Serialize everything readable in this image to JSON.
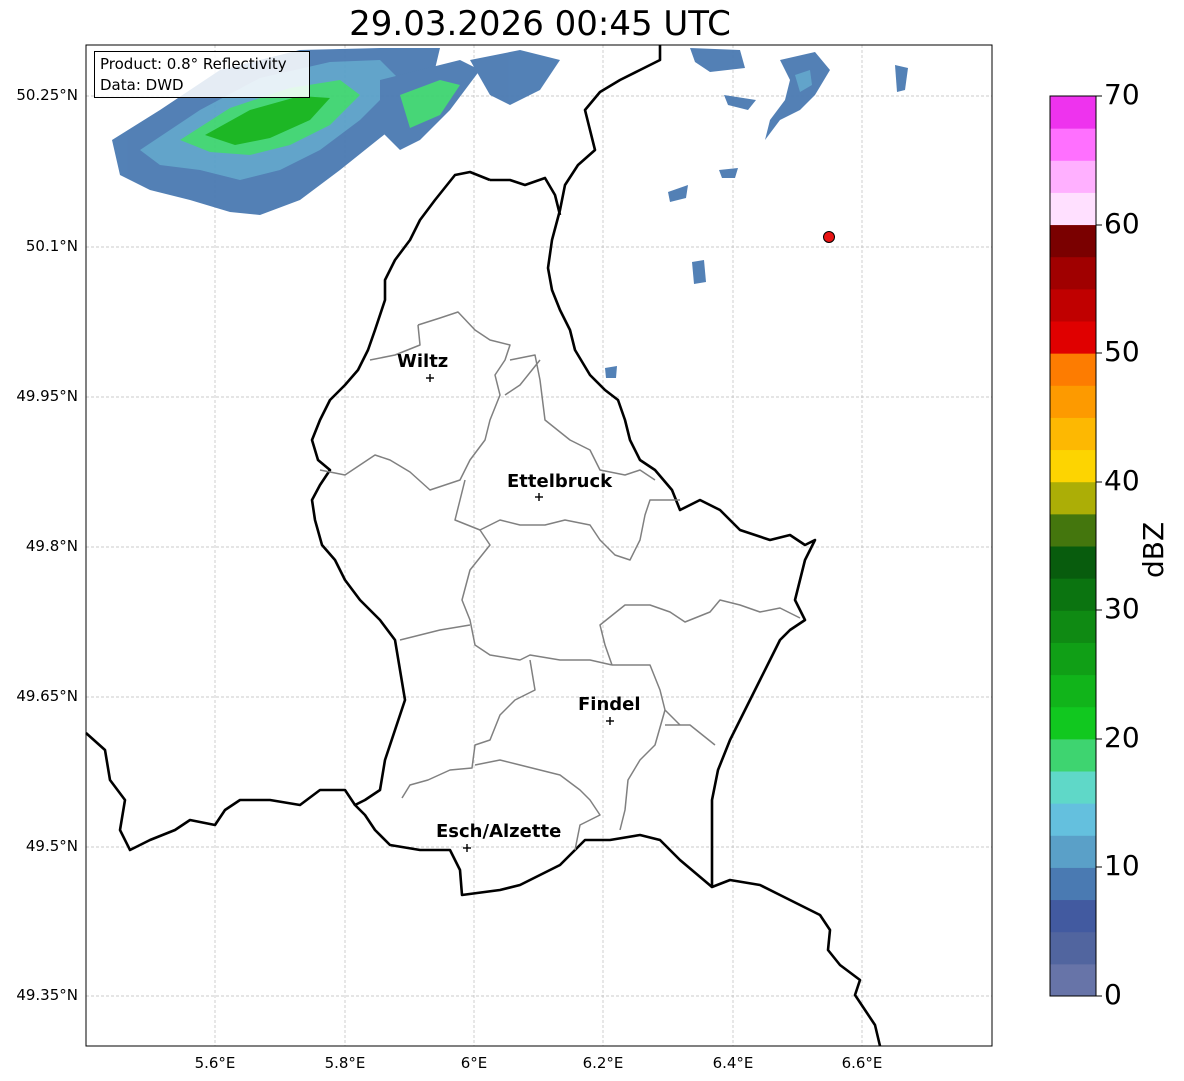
{
  "title": "29.03.2026 00:45 UTC",
  "info_box": {
    "product": "Product: 0.8° Reflectivity",
    "source": "Data: DWD"
  },
  "axes": {
    "lat_ticks": [
      "50.25°N",
      "50.1°N",
      "49.95°N",
      "49.8°N",
      "49.65°N",
      "49.5°N",
      "49.35°N"
    ],
    "lon_ticks": [
      "5.6°E",
      "5.8°E",
      "6°E",
      "6.2°E",
      "6.4°E",
      "6.6°E"
    ]
  },
  "cities": [
    {
      "name": "Wiltz"
    },
    {
      "name": "Ettelbruck"
    },
    {
      "name": "Findel"
    },
    {
      "name": "Esch/Alzette"
    }
  ],
  "colorbar": {
    "title": "dBZ",
    "tick_labels": [
      "0",
      "10",
      "20",
      "30",
      "40",
      "50",
      "60",
      "70"
    ],
    "colors": [
      "#6774a8",
      "#51659f",
      "#425aa0",
      "#4a7ab2",
      "#5aa0c8",
      "#64c0de",
      "#5fd8c8",
      "#3ed470",
      "#11c81f",
      "#11b41a",
      "#109f16",
      "#0f8a13",
      "#0b7410",
      "#085c0d",
      "#44760d",
      "#acae06",
      "#fdd401",
      "#fdb802",
      "#fd9a00",
      "#fd7c01",
      "#e00000",
      "#c00000",
      "#a00000",
      "#7a0000",
      "#ffe0ff",
      "#ffb0ff",
      "#ff70ff",
      "#ee33ee"
    ]
  },
  "radar_marker": {
    "color": "#e81414"
  }
}
